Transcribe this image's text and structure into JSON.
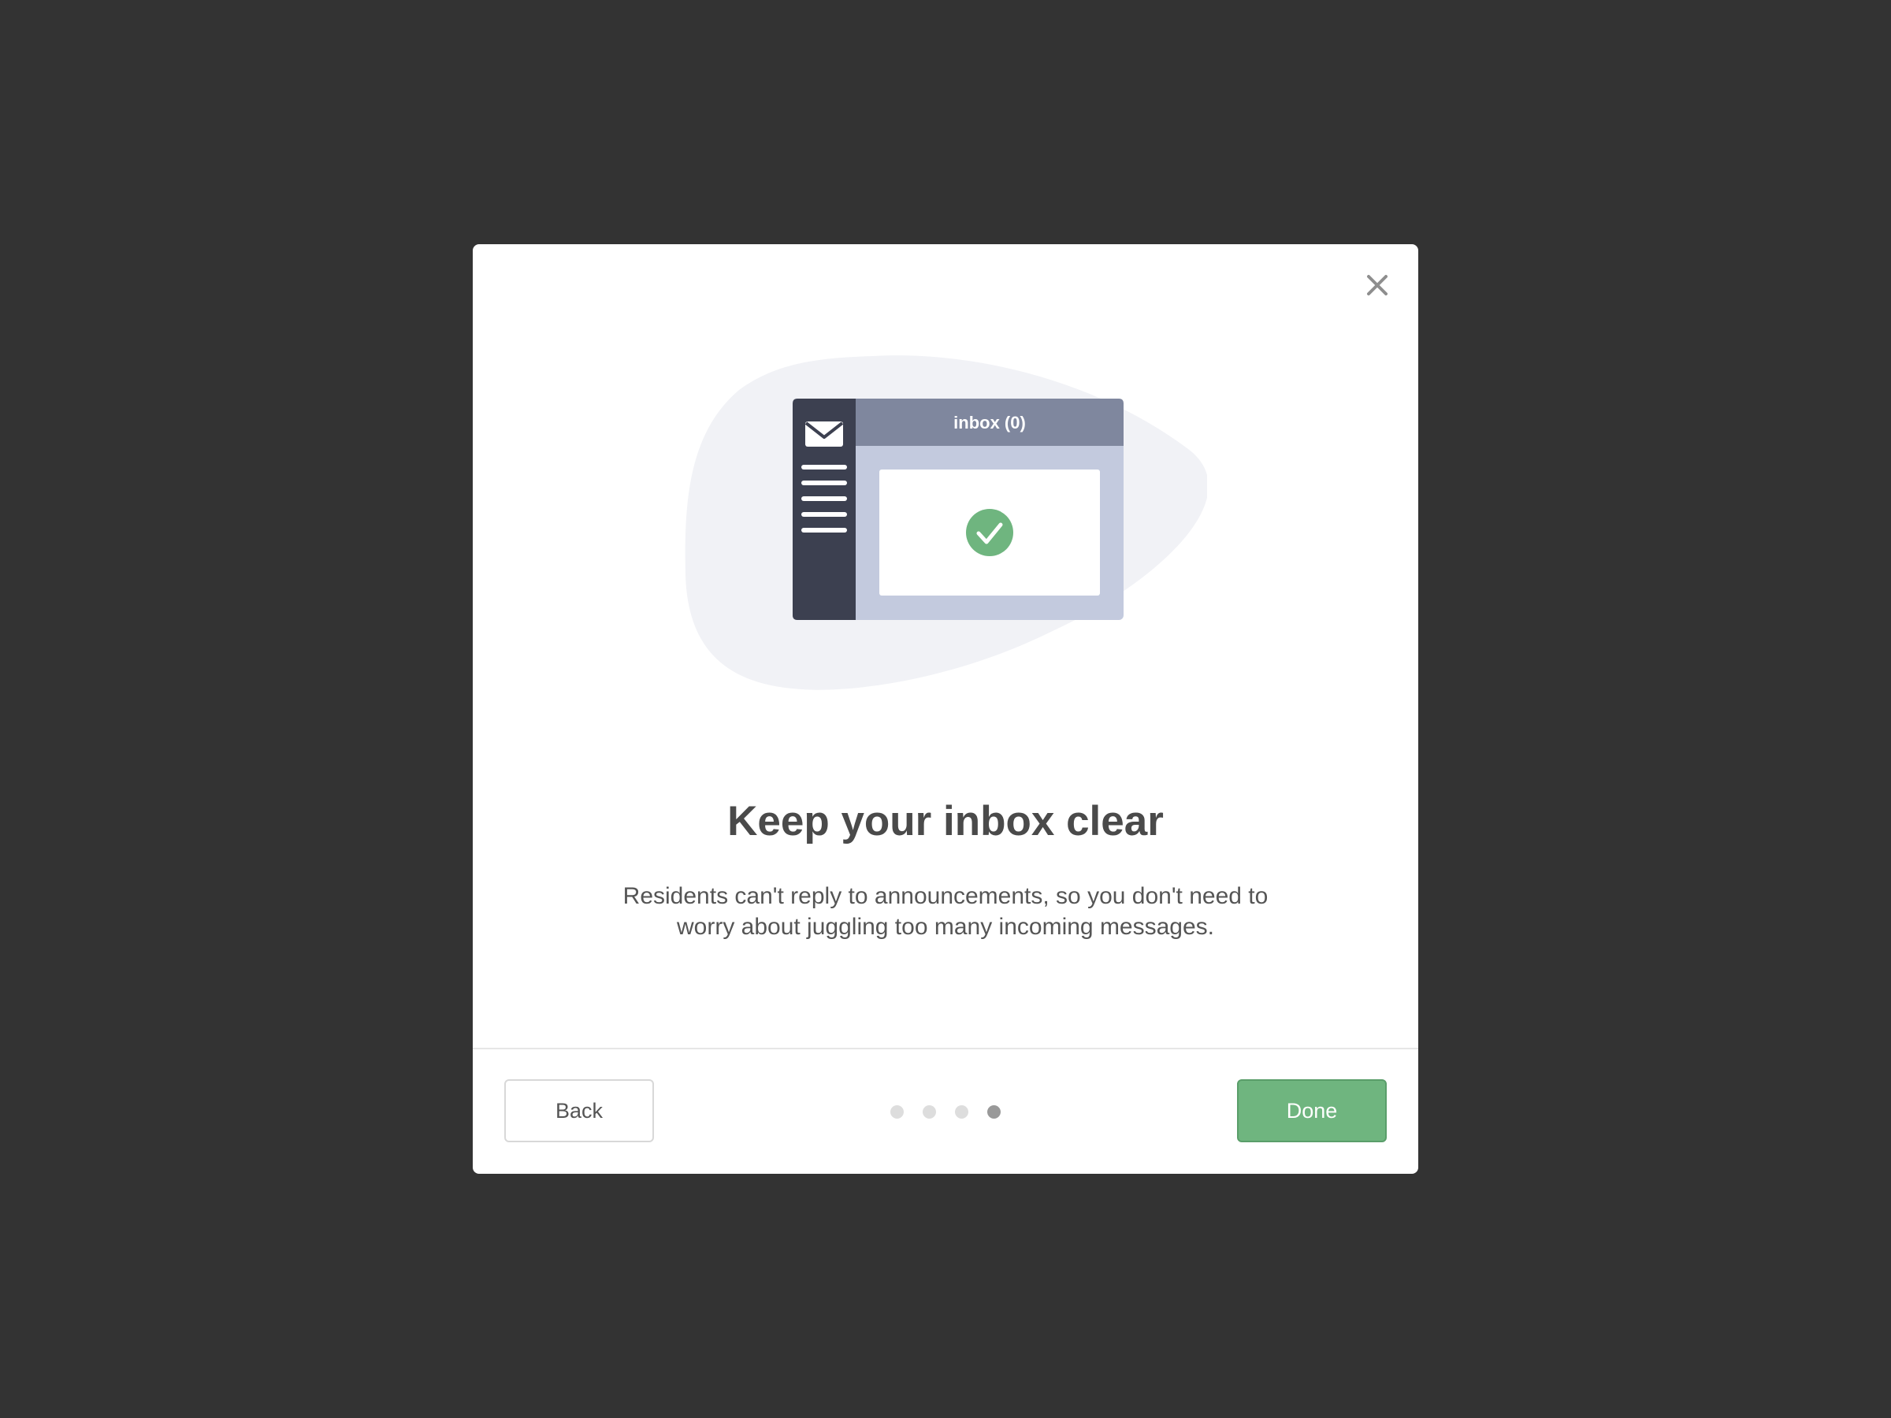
{
  "modal": {
    "title": "Keep your inbox clear",
    "body": "Residents can't reply to announcements, so you don't need to worry about juggling too many incoming messages.",
    "close_icon": "close-icon"
  },
  "illustration": {
    "inbox_label": "inbox (0)",
    "icons": [
      "envelope-icon",
      "menu-lines-icon",
      "checkmark-circle-icon"
    ],
    "colors": {
      "blob": "#f1f2f6",
      "sidebar": "#3c4050",
      "header": "#7f879e",
      "panel": "#c3cade",
      "check": "#6fb57f"
    }
  },
  "footer": {
    "back_label": "Back",
    "done_label": "Done",
    "pagination": {
      "total": 4,
      "current": 4
    }
  },
  "colors": {
    "backdrop": "#333333",
    "accent": "#6fb57f"
  }
}
